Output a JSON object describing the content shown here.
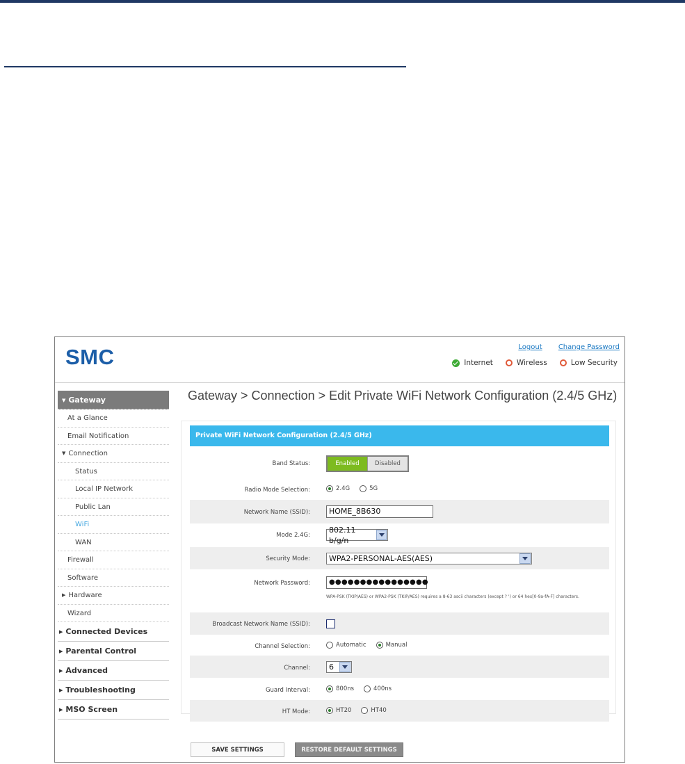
{
  "header": {
    "logo": "SMC",
    "links": {
      "logout": "Logout",
      "change_password": "Change Password"
    },
    "status": {
      "internet": "Internet",
      "wireless": "Wireless",
      "security": "Low Security"
    }
  },
  "sidebar": {
    "items": [
      "Gateway",
      "At a Glance",
      "Email Notification",
      "Connection",
      "Status",
      "Local IP Network",
      "Public Lan",
      "WiFi",
      "WAN",
      "Firewall",
      "Software",
      "Hardware",
      "Wizard",
      "Connected Devices",
      "Parental Control",
      "Advanced",
      "Troubleshooting",
      "MSO Screen"
    ]
  },
  "page_title": "Gateway > Connection > Edit Private WiFi Network Configuration (2.4/5 GHz)",
  "form": {
    "heading": "Private WiFi Network Configuration (2.4/5 GHz)",
    "band_status": {
      "label": "Band Status:",
      "enabled": "Enabled",
      "disabled": "Disabled"
    },
    "radio_mode": {
      "label": "Radio Mode Selection:",
      "opt1": "2.4G",
      "opt2": "5G"
    },
    "ssid": {
      "label": "Network Name (SSID):",
      "value": "HOME_8B630"
    },
    "mode": {
      "label": "Mode 2.4G:",
      "value": "802.11 b/g/n"
    },
    "security": {
      "label": "Security Mode:",
      "value": "WPA2-PERSONAL-AES(AES)"
    },
    "password": {
      "label": "Network Password:",
      "value": "●●●●●●●●●●●●●●●●",
      "hint": "WPA-PSK (TKIP/AES) or WPA2-PSK (TKIP/AES) requires a 8-63 ascii characters (except ? ') or 64 hex[0-9a-fA-F] characters."
    },
    "broadcast": {
      "label": "Broadcast Network Name (SSID):"
    },
    "channel_selection": {
      "label": "Channel Selection:",
      "opt1": "Automatic",
      "opt2": "Manual"
    },
    "channel": {
      "label": "Channel:",
      "value": "6"
    },
    "guard": {
      "label": "Guard Interval:",
      "opt1": "800ns",
      "opt2": "400ns"
    },
    "ht_mode": {
      "label": "HT Mode:",
      "opt1": "HT20",
      "opt2": "HT40"
    }
  },
  "buttons": {
    "save": "SAVE SETTINGS",
    "restore": "RESTORE DEFAULT SETTINGS"
  }
}
